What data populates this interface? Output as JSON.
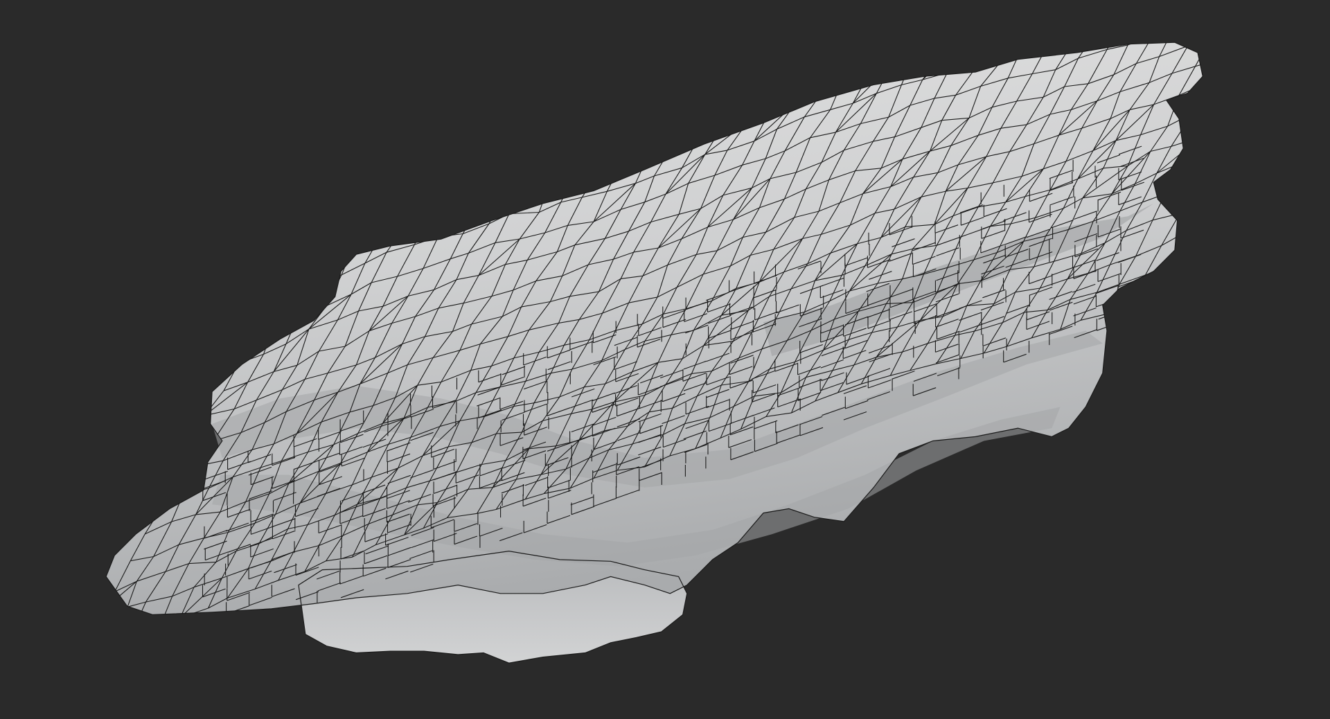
{
  "scene": {
    "background_color": "#2a2a2a",
    "subject": "rock-mesh",
    "mesh_fill_color": "#c9cacb",
    "mesh_highlight_color": "#e4e4e4",
    "mesh_shadow_color": "#8f9194",
    "wireframe_color": "#1b1b1b",
    "display_mode": "shaded-wireframe"
  }
}
